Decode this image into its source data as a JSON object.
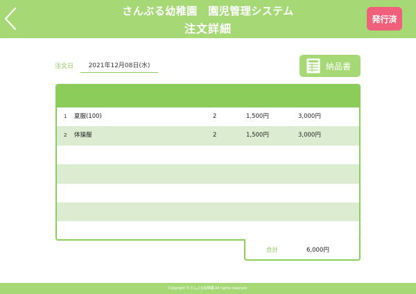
{
  "header": {
    "title": "さんぶる幼稚園　園児管理システム",
    "subtitle": "注文詳細",
    "status_badge": "発行済"
  },
  "order": {
    "date_label": "注文日",
    "date_value": "2021年12月08日(水)"
  },
  "actions": {
    "delivery_note_label": "納品書"
  },
  "table": {
    "rows": [
      {
        "no": "1",
        "name": "夏服(100)",
        "qty": "2",
        "price": "1,500円",
        "amount": "3,000円"
      },
      {
        "no": "2",
        "name": "体操服",
        "qty": "2",
        "price": "1,500円",
        "amount": "3,000円"
      },
      {
        "no": "",
        "name": "",
        "qty": "",
        "price": "",
        "amount": ""
      },
      {
        "no": "",
        "name": "",
        "qty": "",
        "price": "",
        "amount": ""
      },
      {
        "no": "",
        "name": "",
        "qty": "",
        "price": "",
        "amount": ""
      },
      {
        "no": "",
        "name": "",
        "qty": "",
        "price": "",
        "amount": ""
      },
      {
        "no": "",
        "name": "",
        "qty": "",
        "price": "",
        "amount": ""
      }
    ]
  },
  "total": {
    "label": "合計",
    "value": "6,000円"
  },
  "footer": {
    "copyright": "Copyright ©さんぶる幼稚園 All rights reserved."
  },
  "colors": {
    "header_green": "#a6d876",
    "table_green": "#8ccc5a",
    "row_alt": "#dcecd0",
    "badge_red": "#f0607a"
  },
  "icons": {
    "back": "chevron-left-icon",
    "delivery_note": "spreadsheet-icon"
  }
}
